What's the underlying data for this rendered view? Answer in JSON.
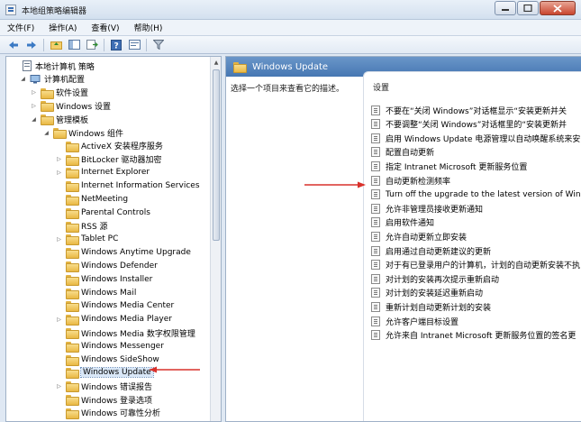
{
  "window": {
    "title": "本地组策略编辑器"
  },
  "menu": [
    "文件(F)",
    "操作(A)",
    "查看(V)",
    "帮助(H)"
  ],
  "toolbar": [
    "back-icon",
    "forward-icon",
    "up-folder-icon",
    "show-hide-tree-icon",
    "export-list-icon",
    "help-icon",
    "properties-icon",
    "filter-icon"
  ],
  "tree": [
    {
      "label": "本地计算机 策略",
      "icon": "doc",
      "indent": 0,
      "toggle": ""
    },
    {
      "label": "计算机配置",
      "icon": "pc",
      "indent": 1,
      "toggle": "open"
    },
    {
      "label": "软件设置",
      "icon": "folder",
      "indent": 2,
      "toggle": "closed"
    },
    {
      "label": "Windows 设置",
      "icon": "folder",
      "indent": 2,
      "toggle": "closed"
    },
    {
      "label": "管理模板",
      "icon": "folder",
      "indent": 2,
      "toggle": "open"
    },
    {
      "label": "Windows 组件",
      "icon": "folder",
      "indent": 3,
      "toggle": "open"
    },
    {
      "label": "ActiveX 安装程序服务",
      "icon": "folder",
      "indent": 4,
      "toggle": ""
    },
    {
      "label": "BitLocker 驱动器加密",
      "icon": "folder",
      "indent": 4,
      "toggle": "closed"
    },
    {
      "label": "Internet Explorer",
      "icon": "folder",
      "indent": 4,
      "toggle": "closed"
    },
    {
      "label": "Internet Information Services",
      "icon": "folder",
      "indent": 4,
      "toggle": ""
    },
    {
      "label": "NetMeeting",
      "icon": "folder",
      "indent": 4,
      "toggle": ""
    },
    {
      "label": "Parental Controls",
      "icon": "folder",
      "indent": 4,
      "toggle": ""
    },
    {
      "label": "RSS 源",
      "icon": "folder",
      "indent": 4,
      "toggle": ""
    },
    {
      "label": "Tablet PC",
      "icon": "folder",
      "indent": 4,
      "toggle": "closed"
    },
    {
      "label": "Windows Anytime Upgrade",
      "icon": "folder",
      "indent": 4,
      "toggle": ""
    },
    {
      "label": "Windows Defender",
      "icon": "folder",
      "indent": 4,
      "toggle": ""
    },
    {
      "label": "Windows Installer",
      "icon": "folder",
      "indent": 4,
      "toggle": ""
    },
    {
      "label": "Windows Mail",
      "icon": "folder",
      "indent": 4,
      "toggle": ""
    },
    {
      "label": "Windows Media Center",
      "icon": "folder",
      "indent": 4,
      "toggle": ""
    },
    {
      "label": "Windows Media Player",
      "icon": "folder",
      "indent": 4,
      "toggle": "closed"
    },
    {
      "label": "Windows Media 数字权限管理",
      "icon": "folder",
      "indent": 4,
      "toggle": ""
    },
    {
      "label": "Windows Messenger",
      "icon": "folder",
      "indent": 4,
      "toggle": ""
    },
    {
      "label": "Windows SideShow",
      "icon": "folder",
      "indent": 4,
      "toggle": ""
    },
    {
      "label": "Windows Update",
      "icon": "folder",
      "indent": 4,
      "toggle": "",
      "selected": true
    },
    {
      "label": "Windows 错误报告",
      "icon": "folder",
      "indent": 4,
      "toggle": "closed"
    },
    {
      "label": "Windows 登录选项",
      "icon": "folder",
      "indent": 4,
      "toggle": ""
    },
    {
      "label": "Windows 可靠性分析",
      "icon": "folder",
      "indent": 4,
      "toggle": ""
    }
  ],
  "right_pane": {
    "header": "Windows Update",
    "description": "选择一个项目来查看它的描述。",
    "settings_header": "设置",
    "settings": [
      "不要在“关闭 Windows”对话框显示“安装更新并关",
      "不要调整“关闭 Windows”对话框里的“安装更新并",
      "启用 Windows Update 电源管理以自动唤醒系统来安",
      "配置自动更新",
      "指定 Intranet Microsoft 更新服务位置",
      "自动更新检测频率",
      "Turn off the upgrade to the latest version of Win",
      "允许非管理员接收更新通知",
      "启用软件通知",
      "允许自动更新立即安装",
      "启用通过自动更新建议的更新",
      "对于有已登录用户的计算机，计划的自动更新安装不执",
      "对计划的安装再次提示重新启动",
      "对计划的安装延迟重新启动",
      "重新计划自动更新计划的安装",
      "允许客户端目标设置",
      "允许来自 Intranet Microsoft 更新服务位置的签名更"
    ]
  },
  "colors": {
    "header_blue": "#4677b3",
    "annotation_red": "#d9312b"
  }
}
